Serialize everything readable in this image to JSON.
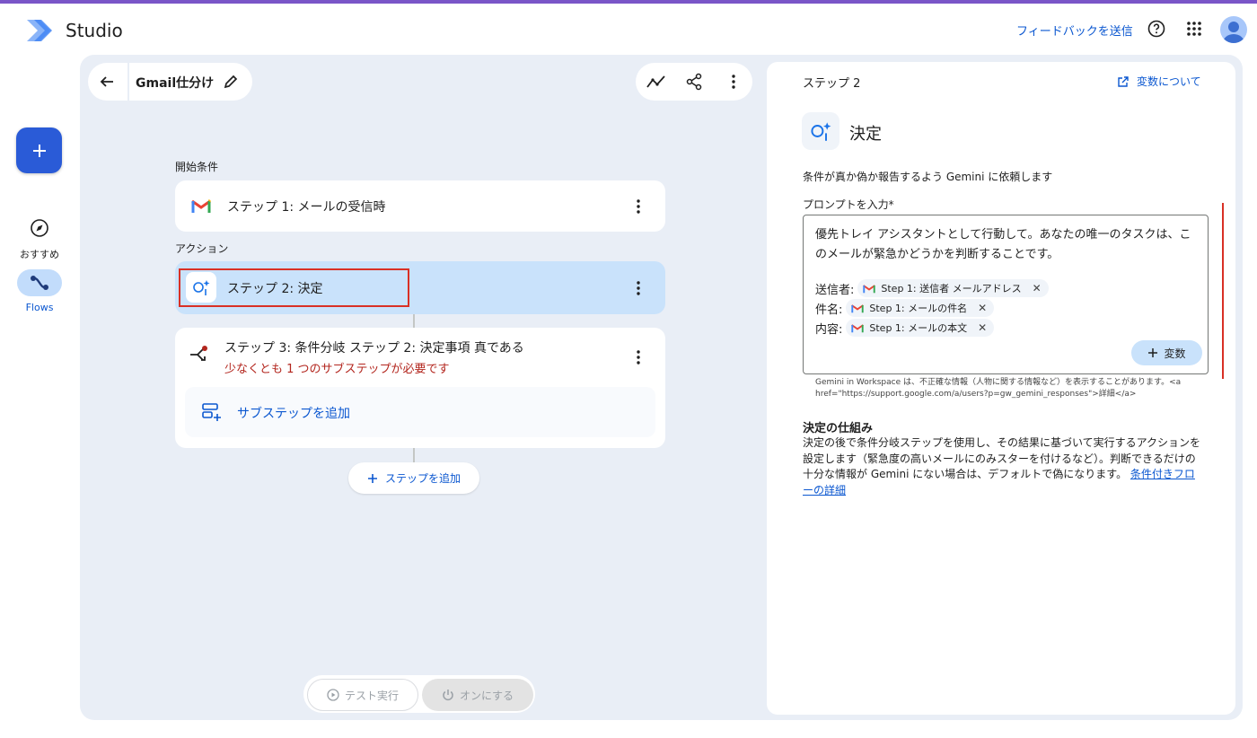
{
  "app": {
    "title": "Studio"
  },
  "header": {
    "feedback": "フィードバックを送信",
    "help_icon": "help-icon",
    "apps_icon": "apps-grid-icon"
  },
  "rail": {
    "create_icon": "plus-icon",
    "items": [
      {
        "label": "おすすめ",
        "icon": "compass-icon",
        "active": false
      },
      {
        "label": "Flows",
        "icon": "flows-icon",
        "active": true
      }
    ]
  },
  "flow": {
    "title": "Gmail仕分け",
    "start_section": "開始条件",
    "action_section": "アクション",
    "steps": [
      {
        "title": "ステップ 1: メールの受信時"
      },
      {
        "title": "ステップ 2: 決定"
      },
      {
        "title": "ステップ 3: 条件分岐 ステップ 2: 決定事項 真である",
        "error": "少なくとも 1 つのサブステップが必要です"
      }
    ],
    "add_substep": "サブステップを追加",
    "add_step": "ステップを追加",
    "test_run": "テスト実行",
    "turn_on": "オンにする"
  },
  "panel": {
    "step_label": "ステップ 2",
    "variables_link": "変数について",
    "title": "決定",
    "description": "条件が真か偽か報告するよう Gemini に依頼します",
    "prompt_label": "プロンプトを入力*",
    "prompt_text": "優先トレイ アシスタントとして行動して。あなたの唯一のタスクは、このメールが緊急かどうかを判断することです。",
    "vars": [
      {
        "label": "送信者:",
        "chip": "Step 1: 送信者 メールアドレス"
      },
      {
        "label": "件名:",
        "chip": "Step 1: メールの件名"
      },
      {
        "label": "内容:",
        "chip": "Step 1: メールの本文"
      }
    ],
    "add_var": "変数",
    "disclaimer": "Gemini in Workspace は、不正確な情報（人物に関する情報など）を表示することがあります。<a href=\"https://support.google.com/a/users?p=gw_gemini_responses\">詳細</a>",
    "how_title": "決定の仕組み",
    "how_body": "決定の後で条件分岐ステップを使用し、その結果に基づいて実行するアクションを設定します（緊急度の高いメールにのみスターを付けるなど）。判断できるだけの十分な情報が Gemini にない場合は、デフォルトで偽になります。",
    "how_link": "条件付きフローの詳細"
  },
  "colors": {
    "accent": "#0b57d0",
    "error": "#b3261e",
    "selected": "#c9e2fb",
    "canvas": "#e9eef6"
  }
}
